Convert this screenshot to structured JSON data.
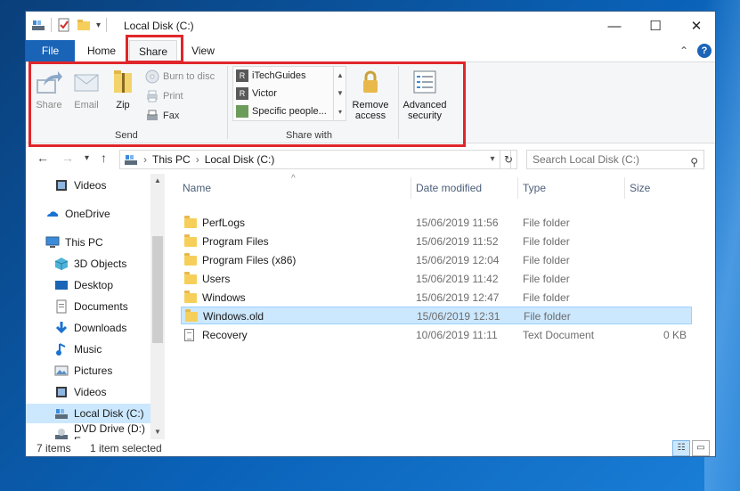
{
  "window": {
    "title": "Local Disk (C:)",
    "controls": {
      "minimize": "—",
      "maximize": "☐",
      "close": "✕"
    }
  },
  "quick_access": {
    "icons": [
      "drive-icon",
      "properties-icon",
      "new-folder-icon"
    ],
    "customize": "▾"
  },
  "tabs": {
    "file": "File",
    "home": "Home",
    "share": "Share",
    "view": "View",
    "collapse": "⌃",
    "help": "?"
  },
  "ribbon": {
    "send": {
      "share": "Share",
      "email": "Email",
      "zip": "Zip",
      "burn": "Burn to disc",
      "print": "Print",
      "fax": "Fax",
      "group_label": "Send"
    },
    "share_with": {
      "items": [
        "iTechGuides",
        "Victor",
        "Specific people..."
      ],
      "group_label": "Share with",
      "remove_access_line1": "Remove",
      "remove_access_line2": "access"
    },
    "advanced": {
      "line1": "Advanced",
      "line2": "security"
    }
  },
  "address": {
    "path": [
      "This PC",
      "Local Disk (C:)"
    ],
    "search_placeholder": "Search Local Disk (C:)"
  },
  "nav": {
    "items": [
      {
        "label": "Videos",
        "icon": "videos-icon"
      },
      {
        "label": "OneDrive",
        "icon": "onedrive-icon"
      },
      {
        "label": "This PC",
        "icon": "this-pc-icon"
      },
      {
        "label": "3D Objects",
        "icon": "3d-objects-icon"
      },
      {
        "label": "Desktop",
        "icon": "desktop-icon"
      },
      {
        "label": "Documents",
        "icon": "documents-icon"
      },
      {
        "label": "Downloads",
        "icon": "downloads-icon"
      },
      {
        "label": "Music",
        "icon": "music-icon"
      },
      {
        "label": "Pictures",
        "icon": "pictures-icon"
      },
      {
        "label": "Videos",
        "icon": "videos-icon"
      },
      {
        "label": "Local Disk (C:)",
        "icon": "drive-icon"
      },
      {
        "label": "DVD Drive (D:) E",
        "icon": "dvd-drive-icon"
      }
    ]
  },
  "columns": {
    "name": "Name",
    "date": "Date modified",
    "type": "Type",
    "size": "Size"
  },
  "files": [
    {
      "name": "PerfLogs",
      "date": "15/06/2019 11:56",
      "type": "File folder",
      "size": ""
    },
    {
      "name": "Program Files",
      "date": "15/06/2019 11:52",
      "type": "File folder",
      "size": ""
    },
    {
      "name": "Program Files (x86)",
      "date": "15/06/2019 12:04",
      "type": "File folder",
      "size": ""
    },
    {
      "name": "Users",
      "date": "15/06/2019 11:42",
      "type": "File folder",
      "size": ""
    },
    {
      "name": "Windows",
      "date": "15/06/2019 12:47",
      "type": "File folder",
      "size": ""
    },
    {
      "name": "Windows.old",
      "date": "15/06/2019 12:31",
      "type": "File folder",
      "size": ""
    },
    {
      "name": "Recovery",
      "date": "10/06/2019 11:11",
      "type": "Text Document",
      "size": "0 KB"
    }
  ],
  "status": {
    "item_count": "7 items",
    "selected": "1 item selected"
  },
  "colors": {
    "accent": "#1a64b7",
    "highlight": "#e0262b",
    "selection": "#cce8ff"
  }
}
